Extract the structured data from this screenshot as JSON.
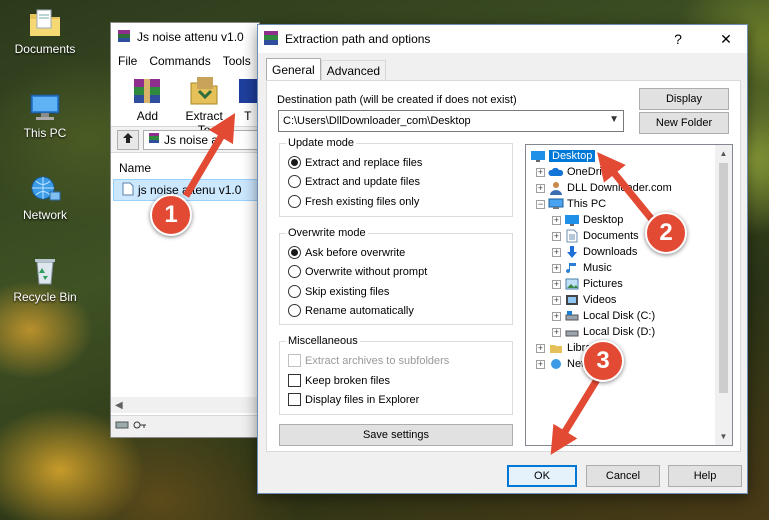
{
  "desktop": {
    "icons": [
      {
        "label": "Documents",
        "icon": "folder-documents-icon"
      },
      {
        "label": "This PC",
        "icon": "computer-icon"
      },
      {
        "label": "Network",
        "icon": "network-icon"
      },
      {
        "label": "Recycle Bin",
        "icon": "recycle-bin-icon"
      }
    ]
  },
  "winrar": {
    "title": "Js noise attenu v1.0",
    "menu": [
      "File",
      "Commands",
      "Tools"
    ],
    "toolbar": [
      {
        "label": "Add",
        "icon": "winrar-add-icon"
      },
      {
        "label": "Extract To",
        "icon": "extract-to-icon"
      },
      {
        "label": "T",
        "icon": "test-icon"
      }
    ],
    "address": "Js noise at",
    "list_header": "Name",
    "file_row": "js noise attenu v1.0"
  },
  "dialog": {
    "title": "Extraction path and options",
    "help": "?",
    "close": "✕",
    "tabs": [
      "General",
      "Advanced"
    ],
    "dest_label": "Destination path (will be created if does not exist)",
    "dest_value": "C:\\Users\\DllDownloader_com\\Desktop",
    "display_btn": "Display",
    "new_folder_btn": "New Folder",
    "update_mode": {
      "title": "Update mode",
      "options": [
        "Extract and replace files",
        "Extract and update files",
        "Fresh existing files only"
      ],
      "selected": 0
    },
    "overwrite_mode": {
      "title": "Overwrite mode",
      "options": [
        "Ask before overwrite",
        "Overwrite without prompt",
        "Skip existing files",
        "Rename automatically"
      ],
      "selected": 0
    },
    "misc": {
      "title": "Miscellaneous",
      "options": [
        "Extract archives to subfolders",
        "Keep broken files",
        "Display files in Explorer"
      ]
    },
    "save_btn": "Save settings",
    "tree": [
      {
        "label": "Desktop",
        "icon": "desktop-icon"
      },
      {
        "label": "OneDrive",
        "icon": "onedrive-icon"
      },
      {
        "label": "DLL Downloader.com",
        "icon": "user-icon"
      },
      {
        "label": "This PC",
        "icon": "computer-icon"
      },
      {
        "label": "Desktop",
        "icon": "desktop-icon"
      },
      {
        "label": "Documents",
        "icon": "documents-icon"
      },
      {
        "label": "Downloads",
        "icon": "downloads-icon"
      },
      {
        "label": "Music",
        "icon": "music-icon"
      },
      {
        "label": "Pictures",
        "icon": "pictures-icon"
      },
      {
        "label": "Videos",
        "icon": "videos-icon"
      },
      {
        "label": "Local Disk (C:)",
        "icon": "disk-icon"
      },
      {
        "label": "Local Disk (D:)",
        "icon": "disk-icon"
      },
      {
        "label": "Libraries",
        "icon": "libraries-icon"
      },
      {
        "label": "Network",
        "icon": "network-icon"
      }
    ],
    "ok_btn": "OK",
    "cancel_btn": "Cancel",
    "help_btn": "Help"
  },
  "annotations": [
    "1",
    "2",
    "3"
  ],
  "colors": {
    "accent": "#0078d7",
    "badge": "#e34a34",
    "arrow": "#e34a34"
  }
}
